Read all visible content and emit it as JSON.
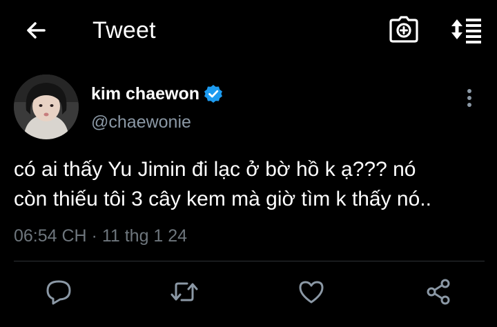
{
  "header": {
    "title": "Tweet",
    "back_icon": "arrow-left-icon",
    "camera_icon": "camera-add-icon",
    "sort_icon": "sort-list-icon"
  },
  "author": {
    "display_name": "kim chaewon",
    "handle": "@chaewonie",
    "verified": true,
    "verified_color": "#1d9bf0"
  },
  "tweet": {
    "text_line1": "có ai thấy Yu Jimin đi lạc ở bờ hồ k ạ??? nó",
    "text_line2": "còn thiếu tôi 3 cây kem mà giờ tìm k thấy nó..",
    "timestamp": "06:54 CH · 11 thg 1 24"
  },
  "actions": {
    "reply_icon": "reply-icon",
    "retweet_icon": "retweet-icon",
    "like_icon": "heart-icon",
    "share_icon": "share-icon"
  },
  "colors": {
    "background": "#000000",
    "text": "#ffffff",
    "secondary_text": "#8b98a5",
    "divider": "#2f3336",
    "icon": "#8b98a5"
  }
}
